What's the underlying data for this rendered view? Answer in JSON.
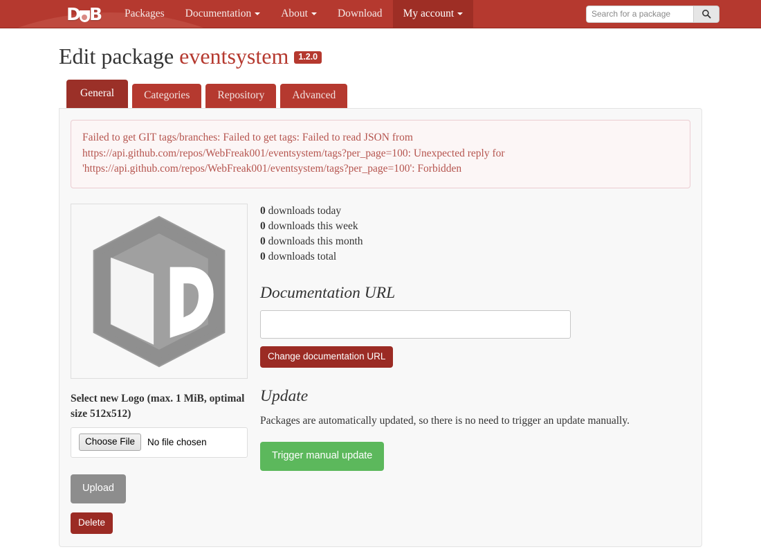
{
  "navbar": {
    "brand": {
      "name": "DUB",
      "letters": [
        "D",
        "u",
        "B"
      ]
    },
    "links": [
      {
        "label": "Packages",
        "caret": false
      },
      {
        "label": "Documentation",
        "caret": true
      },
      {
        "label": "About",
        "caret": true
      },
      {
        "label": "Download",
        "caret": false
      },
      {
        "label": "My account",
        "caret": true
      }
    ],
    "search": {
      "placeholder": "Search for a package",
      "value": "",
      "button_icon": "search-icon"
    },
    "colors": {
      "background": "#b5392f",
      "swoosh": "#bf4a3f",
      "active_item": "#9e2e25"
    }
  },
  "page": {
    "title_prefix": "Edit package",
    "package_name": "eventsystem",
    "version": "1.2.0"
  },
  "tabs": [
    {
      "label": "General",
      "active": true
    },
    {
      "label": "Categories",
      "active": false
    },
    {
      "label": "Repository",
      "active": false
    },
    {
      "label": "Advanced",
      "active": false
    }
  ],
  "alert": {
    "type": "danger",
    "text": "Failed to get GIT tags/branches: Failed to get tags: Failed to read JSON from https://api.github.com/repos/WebFreak001/eventsystem/tags?per_page=100: Unexpected reply for 'https://api.github.com/repos/WebFreak001/eventsystem/tags?per_page=100': Forbidden",
    "colors": {
      "text": "#b5544e",
      "border": "#ebccd1",
      "background": "#fcf6f6"
    }
  },
  "logo_panel": {
    "image_alt": "dub-package-logo",
    "select_label": "Select new Logo (max. 1 MiB, optimal size 512x512)",
    "file_input": {
      "button_label": "Choose File",
      "file_name": "No file chosen"
    },
    "upload_label": "Upload",
    "delete_label": "Delete"
  },
  "downloads": [
    {
      "count": "0",
      "label": "downloads today"
    },
    {
      "count": "0",
      "label": "downloads this week"
    },
    {
      "count": "0",
      "label": "downloads this month"
    },
    {
      "count": "0",
      "label": "downloads total"
    }
  ],
  "documentation": {
    "heading": "Documentation URL",
    "url_value": "",
    "url_placeholder": "",
    "change_button": "Change documentation URL"
  },
  "update": {
    "heading": "Update",
    "description": "Packages are automatically updated, so there is no need to trigger an update manually.",
    "trigger_button": "Trigger manual update",
    "button_color": "#5cb85c"
  }
}
